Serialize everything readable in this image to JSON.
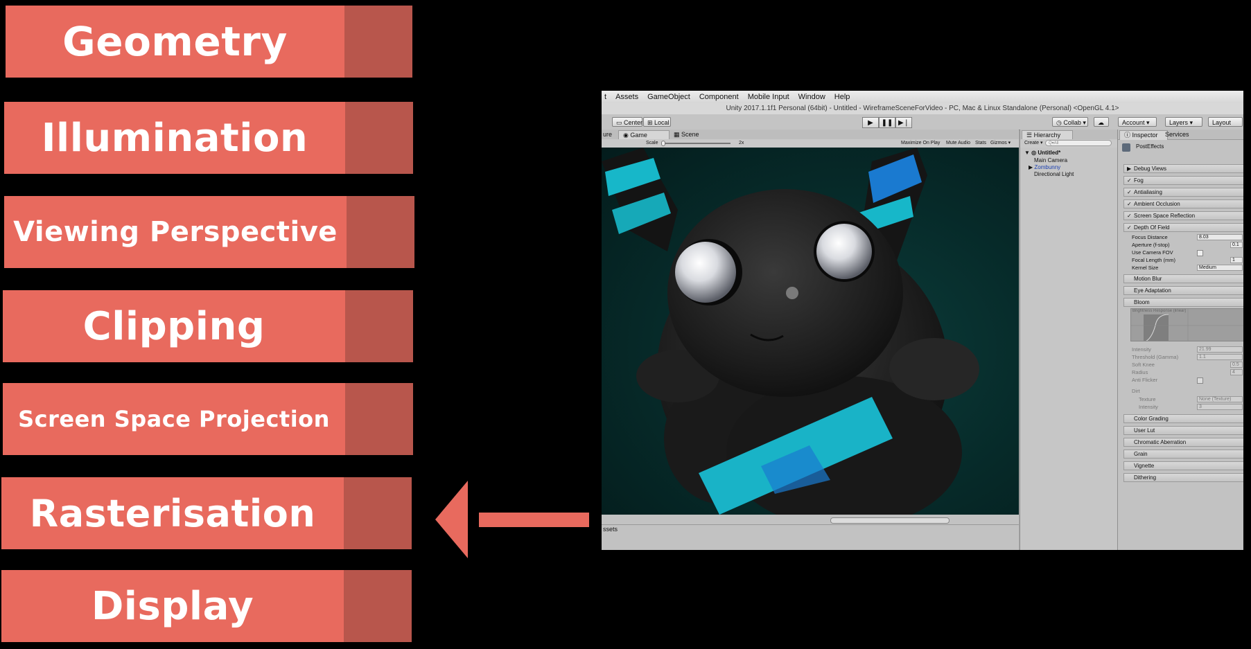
{
  "pipeline": {
    "stages": [
      {
        "label": "Geometry"
      },
      {
        "label": "Illumination"
      },
      {
        "label": "Viewing Perspective"
      },
      {
        "label": "Clipping"
      },
      {
        "label": "Screen Space Projection"
      },
      {
        "label": "Rasterisation"
      },
      {
        "label": "Display"
      }
    ],
    "highlighted_stage": "Rasterisation",
    "colors": {
      "bar": "#e86a5e",
      "bar_shade": "#b8564c",
      "arrow": "#e86a5e",
      "background": "#000000"
    }
  },
  "unity": {
    "menu": [
      "t",
      "Assets",
      "GameObject",
      "Component",
      "Mobile Input",
      "Window",
      "Help"
    ],
    "title": "Unity 2017.1.1f1 Personal (64bit) - Untitled - WireframeSceneForVideo - PC, Mac & Linux Standalone (Personal) <OpenGL 4.1>",
    "toolbar": {
      "center": "Center",
      "local": "Local",
      "collab": "Collab ▾",
      "account": "Account ▾",
      "layers": "Layers ▾",
      "layout": "Layout"
    },
    "game": {
      "tab_game": "Game",
      "tab_scene": "Scene",
      "tab_left": "ure",
      "scale_label": "Scale",
      "scale_value": "2x",
      "maximize": "Maximize On Play",
      "mute": "Mute Audio",
      "stats": "Stats",
      "gizmos": "Gizmos ▾",
      "assets_label": "ssets"
    },
    "hierarchy": {
      "tab": "Hierarchy",
      "create": "Create ▾",
      "search_placeholder": "Q▾All",
      "scene": "Untitled*",
      "items": [
        "Main Camera",
        "Zombunny",
        "Directional Light"
      ]
    },
    "inspector": {
      "tab": "Inspector",
      "tab2": "Services",
      "object": "PostEffects",
      "effects": [
        {
          "name": "Debug Views",
          "state": "▶"
        },
        {
          "name": "Fog",
          "state": "✓"
        },
        {
          "name": "Antialiasing",
          "state": "✓"
        },
        {
          "name": "Ambient Occlusion",
          "state": "✓"
        },
        {
          "name": "Screen Space Reflection",
          "state": "✓"
        },
        {
          "name": "Depth Of Field",
          "state": "✓"
        }
      ],
      "dof_props": [
        {
          "label": "Focus Distance",
          "value": "8.03"
        },
        {
          "label": "Aperture (f-stop)",
          "value": "0.1"
        },
        {
          "label": "Use Camera FOV",
          "value": ""
        },
        {
          "label": "Focal Length (mm)",
          "value": "1"
        },
        {
          "label": "Kernel Size",
          "value": "Medium"
        }
      ],
      "effects2": [
        {
          "name": "Motion Blur"
        },
        {
          "name": "Eye Adaptation"
        },
        {
          "name": "Bloom"
        }
      ],
      "bloom_graph_label": "Brightness Response (linear)",
      "bloom_props": [
        {
          "label": "Intensity",
          "value": "21.99"
        },
        {
          "label": "Threshold (Gamma)",
          "value": "1.1"
        },
        {
          "label": "Soft Knee",
          "value": "0.5"
        },
        {
          "label": "Radius",
          "value": "4"
        },
        {
          "label": "Anti Flicker",
          "value": ""
        }
      ],
      "dirt_label": "Dirt",
      "dirt_props": [
        {
          "label": "Texture",
          "value": "None (Texture)"
        },
        {
          "label": "Intensity",
          "value": "3"
        }
      ],
      "effects3": [
        {
          "name": "Color Grading"
        },
        {
          "name": "User Lut"
        },
        {
          "name": "Chromatic Aberration"
        },
        {
          "name": "Grain"
        },
        {
          "name": "Vignette"
        },
        {
          "name": "Dithering"
        }
      ]
    }
  }
}
